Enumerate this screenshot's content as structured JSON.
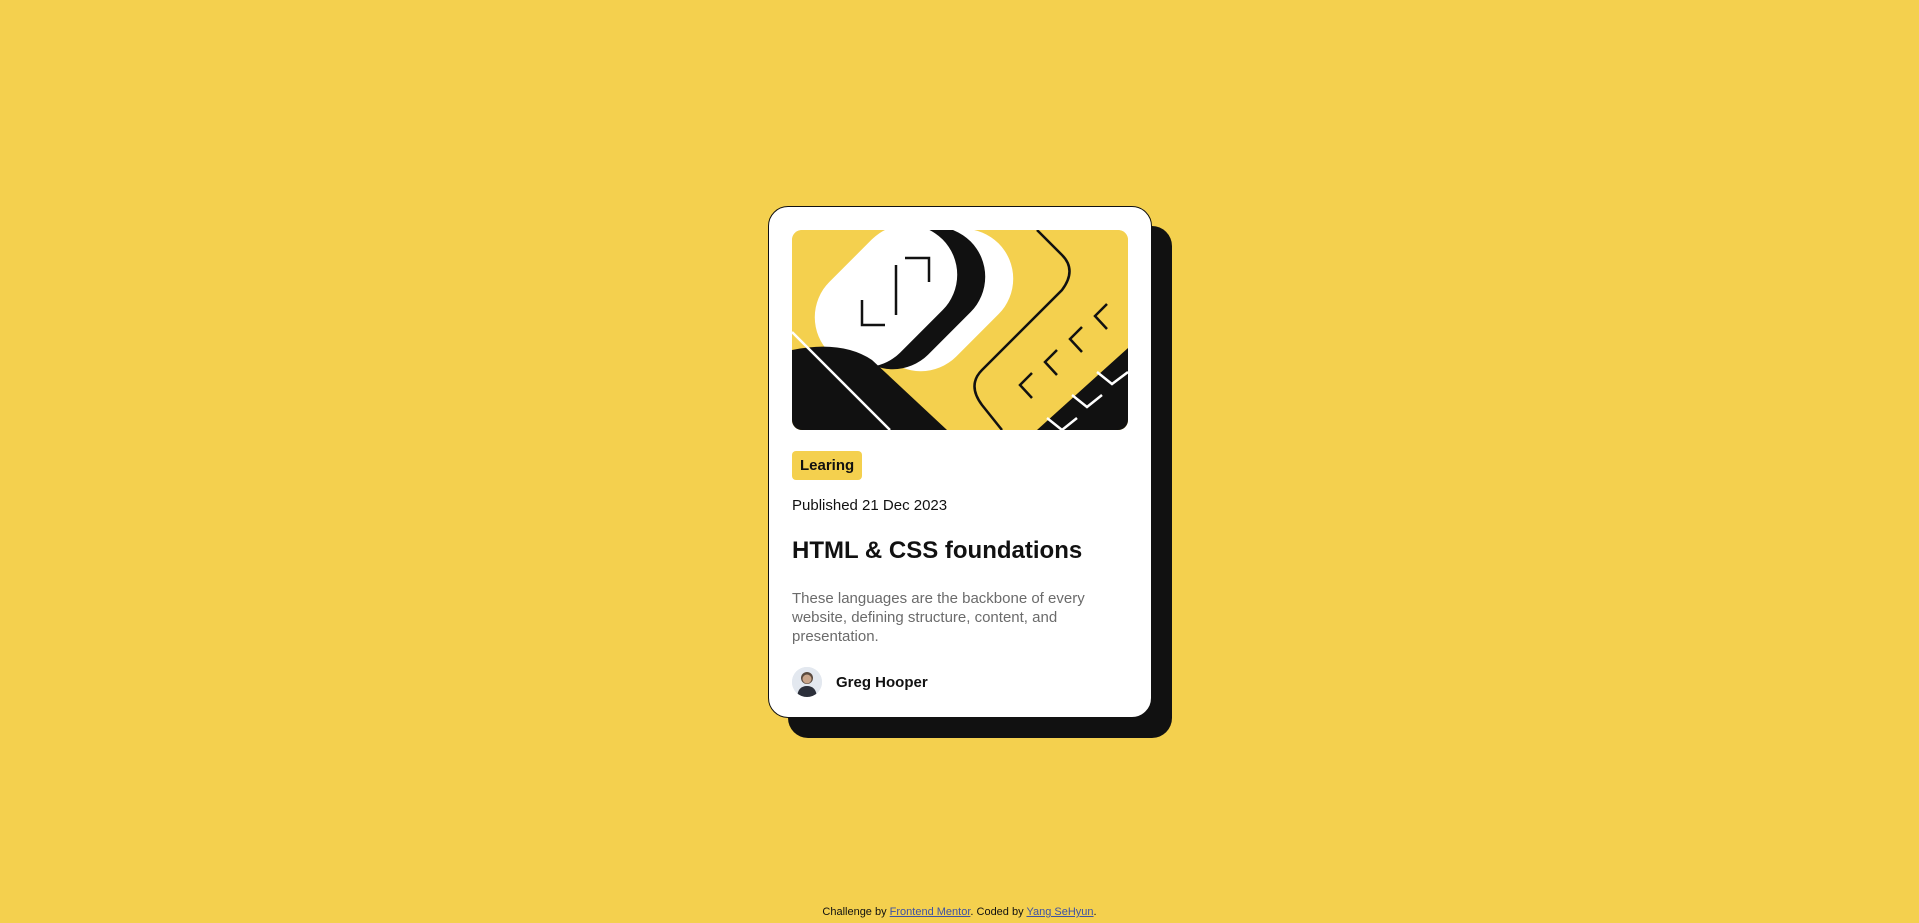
{
  "card": {
    "tag": "Learing",
    "published": "Published 21 Dec 2023",
    "title": "HTML & CSS foundations",
    "description": "These languages are the backbone of every website, defining structure, content, and presentation.",
    "author": "Greg Hooper",
    "image_icon": "code-illustration",
    "avatar_icon": "person-avatar"
  },
  "footer": {
    "prefix": "Challenge by",
    "link1": "Frontend Mentor",
    "middle": ". Coded by",
    "link2": "Yang SeHyun",
    "suffix": "."
  },
  "colors": {
    "background": "#F4D04E",
    "dark": "#111111",
    "muted_text": "#6B6B6B",
    "card": "#FFFFFF"
  }
}
